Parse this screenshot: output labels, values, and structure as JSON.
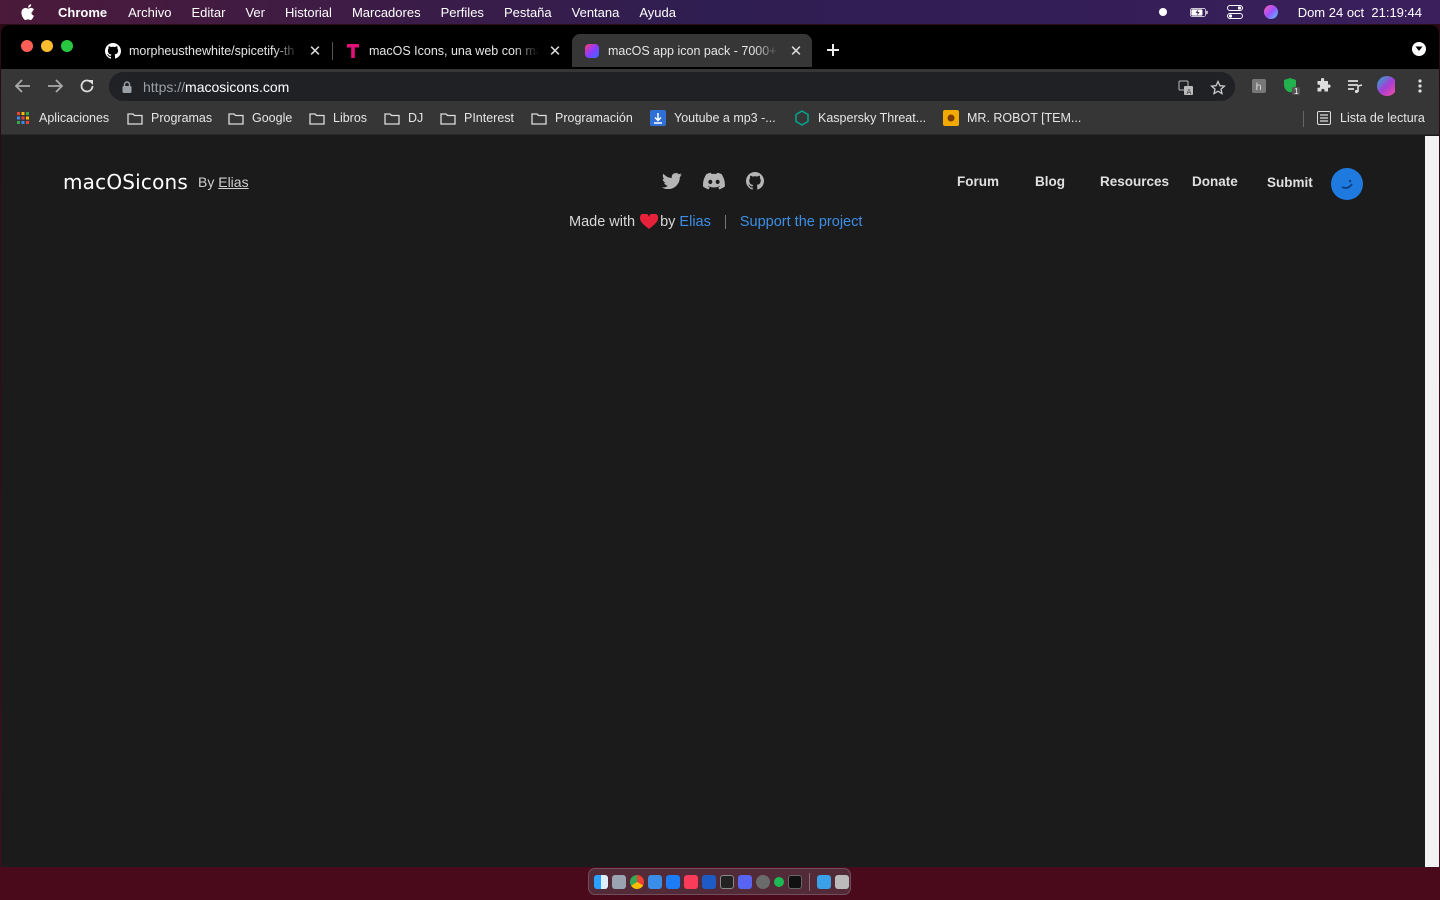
{
  "menubar": {
    "app_name": "Chrome",
    "menus": [
      "Archivo",
      "Editar",
      "Ver",
      "Historial",
      "Marcadores",
      "Perfiles",
      "Pestaña",
      "Ventana",
      "Ayuda"
    ],
    "datetime": "Dom 24 oct  21:19:44"
  },
  "tabs": [
    {
      "title": "morpheusthewhite/spicetify-th",
      "icon": "github-icon"
    },
    {
      "title": "macOS Icons, una web con más",
      "icon": "t-logo-icon"
    },
    {
      "title": "macOS app icon pack - 7000+",
      "icon": "macosicons-icon"
    }
  ],
  "omnibox": {
    "scheme": "https://",
    "host": "macosicons.com"
  },
  "extensions": {
    "badge_count": "1"
  },
  "bookmarks": {
    "apps": "Aplicaciones",
    "items": [
      "Programas",
      "Google",
      "Libros",
      "DJ",
      "PInterest",
      "Programación",
      "Youtube a mp3 -...",
      "Kaspersky Threat...",
      "MR. ROBOT [TEM..."
    ],
    "reading_list": "Lista de lectura"
  },
  "site": {
    "logo": "macOSicons",
    "by_prefix": "By",
    "by_author": "Elias",
    "nav": [
      "Forum",
      "Blog",
      "Resources",
      "Donate",
      "Submit"
    ],
    "made_with_prefix": "Made with",
    "made_with_by": "by",
    "made_with_author": "Elias",
    "support_link": "Support the project"
  },
  "colors": {
    "accent_blue": "#3b8fe6",
    "avatar_blue": "#1f7ae0",
    "heart_red": "#e8213a",
    "page_bg": "#1b1b1b"
  }
}
